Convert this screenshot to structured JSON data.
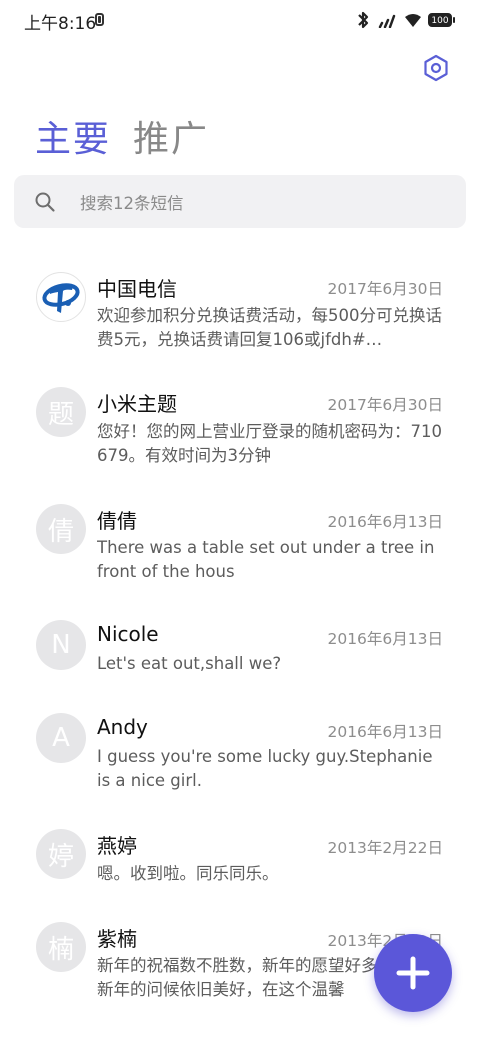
{
  "status_bar": {
    "time": "上午8:16",
    "battery": "100"
  },
  "tabs": {
    "primary": "主要",
    "promotions": "推广"
  },
  "search": {
    "placeholder": "搜索12条短信"
  },
  "messages": [
    {
      "avatar": "",
      "sender": "中国电信",
      "date": "2017年6月30日",
      "preview": "欢迎参加积分兑换话费活动，每500分可兑换话费5元，兑换话费请回复106或jfdh#…"
    },
    {
      "avatar": "题",
      "sender": "小米主题",
      "date": "2017年6月30日",
      "preview": "您好！您的网上营业厅登录的随机密码为：710679。有效时间为3分钟"
    },
    {
      "avatar": "倩",
      "sender": "倩倩",
      "date": "2016年6月13日",
      "preview": "There was a table set out under a tree in front of the hous"
    },
    {
      "avatar": "N",
      "sender": "Nicole",
      "date": "2016年6月13日",
      "preview": "Let's eat out,shall we?"
    },
    {
      "avatar": "A",
      "sender": "Andy",
      "date": "2016年6月13日",
      "preview": "I guess you're some lucky guy.Stephanie is a nice girl."
    },
    {
      "avatar": "婷",
      "sender": "燕婷",
      "date": "2013年2月22日",
      "preview": "嗯。收到啦。同乐同乐。"
    },
    {
      "avatar": "楠",
      "sender": "紫楠",
      "date": "2013年2月22日",
      "preview": "新年的祝福数不胜数，新年的愿望好多好多，新年的问候依旧美好，在这个温馨"
    }
  ],
  "colors": {
    "accent": "#5a5fd6",
    "fab": "#5b57d9"
  }
}
